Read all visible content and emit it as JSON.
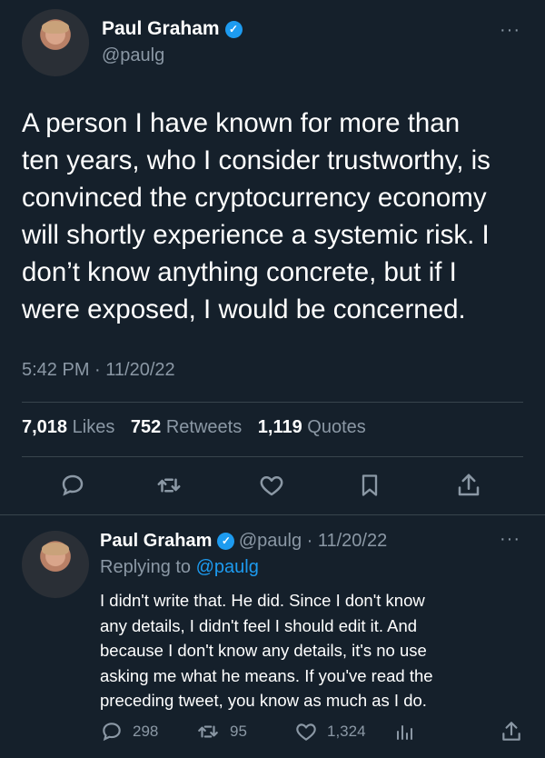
{
  "tweet": {
    "author_name": "Paul Graham",
    "author_handle": "@paulg",
    "more_label": "···",
    "lines": [
      "A person I have known for more than",
      "ten years, who I consider trustworthy, is",
      "convinced the cryptocurrency economy",
      "will shortly experience a systemic risk. I",
      "don’t know anything concrete, but if I",
      "were exposed, I would be concerned."
    ],
    "timestamp": "5:42 PM · 11/20/22",
    "stats": {
      "likes_count": "7,018",
      "likes_label": "Likes",
      "retweets_count": "752",
      "retweets_label": "Retweets",
      "quotes_count": "1,119",
      "quotes_label": "Quotes"
    },
    "actions": [
      "reply-icon",
      "retweet-icon",
      "like-icon",
      "bookmark-icon",
      "share-icon"
    ]
  },
  "reply": {
    "author_name": "Paul Graham",
    "meta": "@paulg · 11/20/22",
    "replying_prefix": "Replying to",
    "replying_handle": "@paulg",
    "more_label": "···",
    "lines": [
      "I didn't write that. He did. Since I don't know",
      "any details, I didn't feel I should edit it. And",
      "because I don't know any details, it's no use",
      "asking me what he means. If you've read the",
      "preceding tweet, you know as much as I do."
    ],
    "counts": {
      "replies": "298",
      "retweets": "95",
      "likes": "1,324"
    }
  },
  "colors": {
    "background": "#15202b",
    "text": "#ffffff",
    "secondary": "#8b98a5",
    "accent": "#1d9bf0",
    "divider": "#38444d"
  }
}
